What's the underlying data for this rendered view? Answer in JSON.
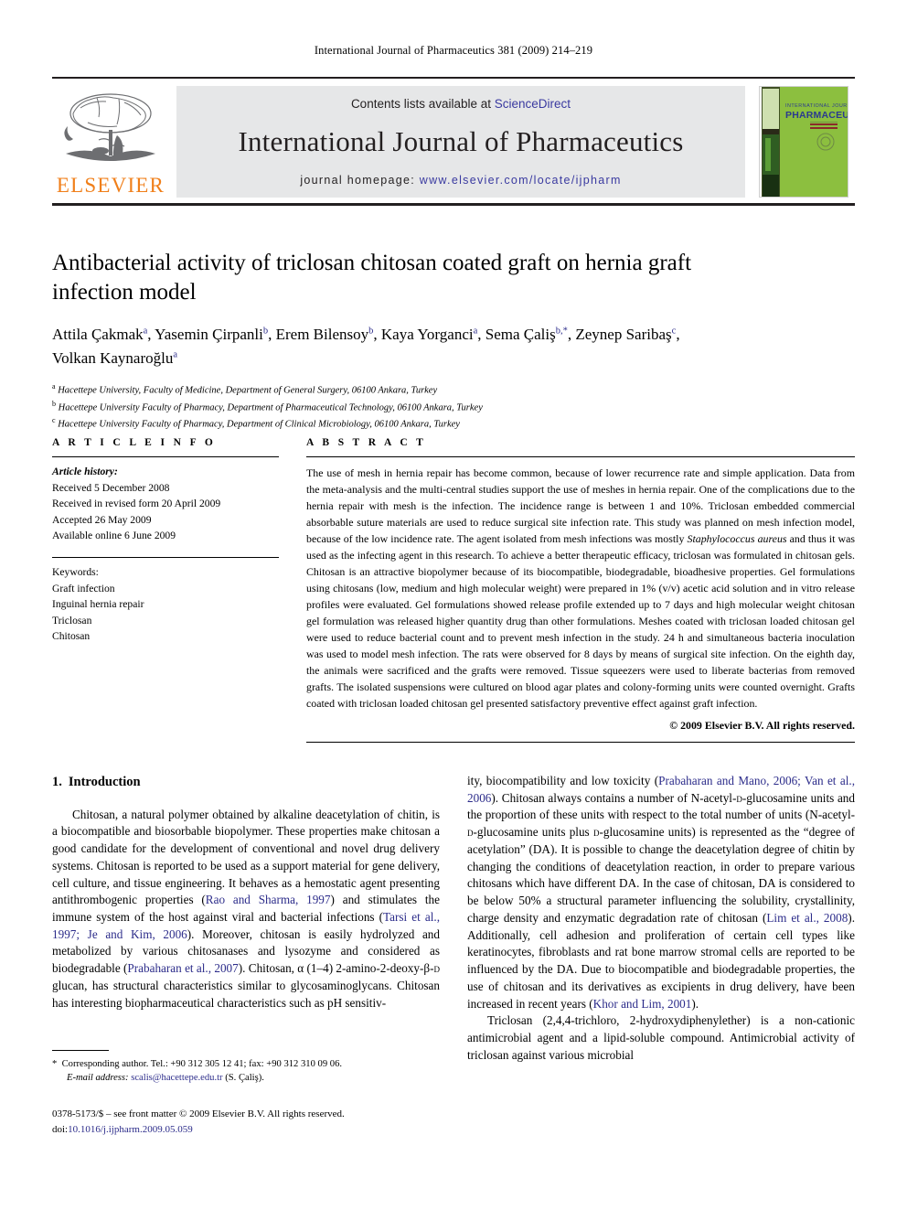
{
  "running_head": "International Journal of Pharmaceutics 381 (2009) 214–219",
  "masthead": {
    "publisher_name": "ELSEVIER",
    "contents_prefix": "Contents lists available at ",
    "contents_link": "ScienceDirect",
    "journal_title": "International Journal of Pharmaceutics",
    "homepage_prefix": "journal homepage: ",
    "homepage_url": "www.elsevier.com/locate/ijpharm",
    "cover_line1": "INTERNATIONAL JOURNAL OF",
    "cover_line2": "PHARMACEUTICS",
    "link_color": "#3a3aa0",
    "elsevier_orange": "#f07f1a",
    "band_gray": "#e6e7e8"
  },
  "article": {
    "title": "Antibacterial activity of triclosan chitosan coated graft on hernia graft infection model",
    "authors_html": "Attila Çakmak<sup>a</sup>, Yasemin Çirpanli<sup>b</sup>, Erem Bilensoy<sup>b</sup>, Kaya Yorganci<sup>a</sup>, Sema Çaliş<sup>b,*</sup>, Zeynep Saribaş<sup>c</sup>, Volkan Kaynaroğlu<sup>a</sup>",
    "affiliations": [
      {
        "mark": "a",
        "text": "Hacettepe University, Faculty of Medicine, Department of General Surgery, 06100 Ankara, Turkey"
      },
      {
        "mark": "b",
        "text": "Hacettepe University Faculty of Pharmacy, Department of Pharmaceutical Technology, 06100 Ankara, Turkey"
      },
      {
        "mark": "c",
        "text": "Hacettepe University Faculty of Pharmacy, Department of Clinical Microbiology, 06100 Ankara, Turkey"
      }
    ]
  },
  "article_info": {
    "heading": "A R T I C L E    I N F O",
    "history_label": "Article history:",
    "history": [
      "Received 5 December 2008",
      "Received in revised form 20 April 2009",
      "Accepted 26 May 2009",
      "Available online 6 June 2009"
    ],
    "keywords_label": "Keywords:",
    "keywords": [
      "Graft infection",
      "Inguinal hernia repair",
      "Triclosan",
      "Chitosan"
    ]
  },
  "abstract": {
    "heading": "A B S T R A C T",
    "text_html": "The use of mesh in hernia repair has become common, because of lower recurrence rate and simple application. Data from the meta-analysis and the multi-central studies support the use of meshes in hernia repair. One of the complications due to the hernia repair with mesh is the infection. The incidence range is between 1 and 10%. Triclosan embedded commercial absorbable suture materials are used to reduce surgical site infection rate. This study was planned on mesh infection model, because of the low incidence rate. The agent isolated from mesh infections was mostly <i>Staphylococcus aureus</i> and thus it was used as the infecting agent in this research. To achieve a better therapeutic efficacy, triclosan was formulated in chitosan gels. Chitosan is an attractive biopolymer because of its biocompatible, biodegradable, bioadhesive properties. Gel formulations using chitosans (low, medium and high molecular weight) were prepared in 1% (v/v) acetic acid solution and in vitro release profiles were evaluated. Gel formulations showed release profile extended up to 7 days and high molecular weight chitosan gel formulation was released higher quantity drug than other formulations. Meshes coated with triclosan loaded chitosan gel were used to reduce bacterial count and to prevent mesh infection in the study. 24 h and simultaneous bacteria inoculation was used to model mesh infection. The rats were observed for 8 days by means of surgical site infection. On the eighth day, the animals were sacrificed and the grafts were removed. Tissue squeezers were used to liberate bacterias from removed grafts. The isolated suspensions were cultured on blood agar plates and colony-forming units were counted overnight. Grafts coated with triclosan loaded chitosan gel presented satisfactory preventive effect against graft infection.",
    "copyright": "© 2009 Elsevier B.V. All rights reserved."
  },
  "introduction": {
    "number": "1.",
    "heading": "Introduction",
    "left_paragraph_html": "Chitosan, a natural polymer obtained by alkaline deacetylation of chitin, is a biocompatible and biosorbable biopolymer. These properties make chitosan a good candidate for the development of conventional and novel drug delivery systems. Chitosan is reported to be used as a support material for gene delivery, cell culture, and tissue engineering. It behaves as a hemostatic agent presenting antithrombogenic properties (<span class=\"ref\">Rao and Sharma, 1997</span>) and stimulates the immune system of the host against viral and bacterial infections (<span class=\"ref\">Tarsi et al., 1997; Je and Kim, 2006</span>). Moreover, chitosan is easily hydrolyzed and metabolized by various chitosanases and lysozyme and considered as biodegradable (<span class=\"ref\">Prabaharan et al., 2007</span>). Chitosan, α (1–4) 2-amino-2-deoxy-β-<span class=\"sc\">d</span> glucan, has structural characteristics similar to glycosaminoglycans. Chitosan has interesting biopharmaceutical characteristics such as pH sensitiv-",
    "right_paragraph1_html": "ity, biocompatibility and low toxicity (<span class=\"ref\">Prabaharan and Mano, 2006; Van et al., 2006</span>). Chitosan always contains a number of N-acetyl-<span class=\"sc\">d</span>-glucosamine units and the proportion of these units with respect to the total number of units (N-acetyl-<span class=\"sc\">d</span>-glucosamine units plus <span class=\"sc\">d</span>-glucosamine units) is represented as the “degree of acetylation” (DA). It is possible to change the deacetylation degree of chitin by changing the conditions of deacetylation reaction, in order to prepare various chitosans which have different DA. In the case of chitosan, DA is considered to be below 50% a structural parameter influencing the solubility, crystallinity, charge density and enzymatic degradation rate of chitosan (<span class=\"ref\">Lim et al., 2008</span>). Additionally, cell adhesion and proliferation of certain cell types like keratinocytes, fibroblasts and rat bone marrow stromal cells are reported to be influenced by the DA. Due to biocompatible and biodegradable properties, the use of chitosan and its derivatives as excipients in drug delivery, have been increased in recent years (<span class=\"ref\">Khor and Lim, 2001</span>).",
    "right_paragraph2_html": "Triclosan (2,4,4-trichloro, 2-hydroxydiphenylether) is a non-cationic antimicrobial agent and a lipid-soluble compound. Antimicrobial activity of triclosan against various microbial"
  },
  "footnote": {
    "marker": "*",
    "line1": "Corresponding author. Tel.: +90 312 305 12 41; fax: +90 312 310 09 06.",
    "email_label": "E-mail address:",
    "email": "scalis@hacettepe.edu.tr",
    "email_owner": "(S. Çaliş)."
  },
  "issn_footer": {
    "line1": "0378-5173/$ – see front matter © 2009 Elsevier B.V. All rights reserved.",
    "doi_label": "doi:",
    "doi_value": "10.1016/j.ijpharm.2009.05.059"
  }
}
